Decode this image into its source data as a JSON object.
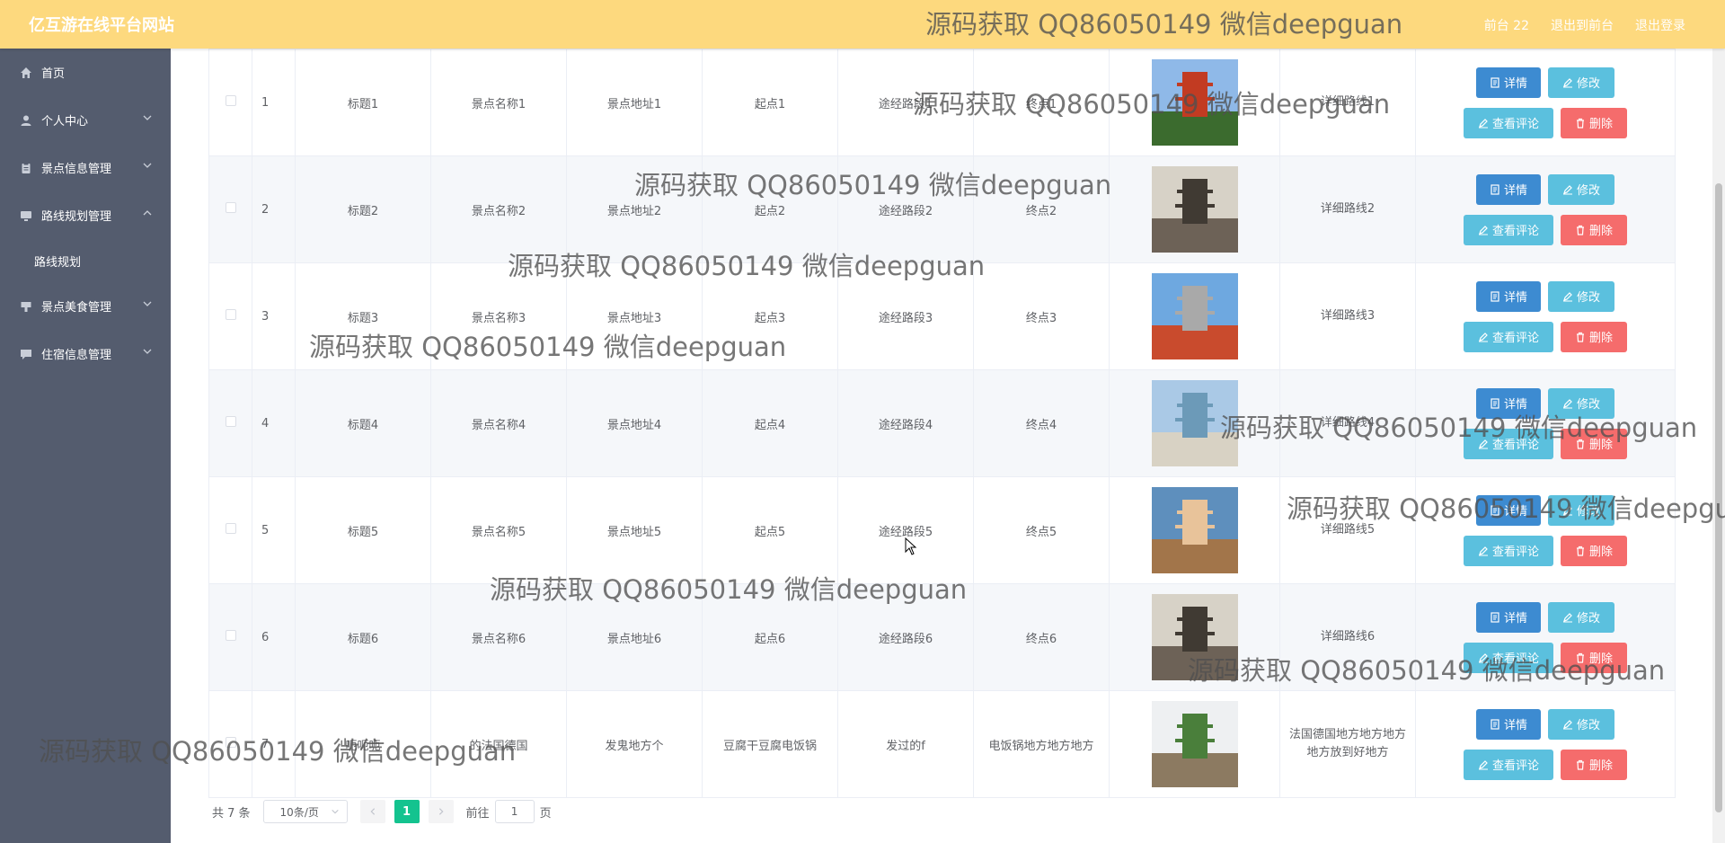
{
  "header": {
    "brand": "亿互游在线平台网站",
    "links": [
      "前台 22",
      "退出到前台",
      "退出登录"
    ]
  },
  "sidebar": {
    "items": [
      {
        "label": "首页",
        "icon": "home-icon"
      },
      {
        "label": "个人中心",
        "icon": "user-icon"
      },
      {
        "label": "景点信息管理",
        "icon": "clipboard-icon"
      },
      {
        "label": "路线规划管理",
        "icon": "monitor-icon"
      },
      {
        "label": "景点美食管理",
        "icon": "flag-icon"
      },
      {
        "label": "住宿信息管理",
        "icon": "chat-icon"
      }
    ],
    "sub_item": "路线规划"
  },
  "table": {
    "rows": [
      {
        "no": "1",
        "title": "标题1",
        "spot": "景点名称1",
        "addr": "景点地址1",
        "start": "起点1",
        "via": "途经路段1",
        "end": "终点1",
        "detail": "详细路线1"
      },
      {
        "no": "2",
        "title": "标题2",
        "spot": "景点名称2",
        "addr": "景点地址2",
        "start": "起点2",
        "via": "途经路段2",
        "end": "终点2",
        "detail": "详细路线2"
      },
      {
        "no": "3",
        "title": "标题3",
        "spot": "景点名称3",
        "addr": "景点地址3",
        "start": "起点3",
        "via": "途经路段3",
        "end": "终点3",
        "detail": "详细路线3"
      },
      {
        "no": "4",
        "title": "标题4",
        "spot": "景点名称4",
        "addr": "景点地址4",
        "start": "起点4",
        "via": "途经路段4",
        "end": "终点4",
        "detail": "详细路线4"
      },
      {
        "no": "5",
        "title": "标题5",
        "spot": "景点名称5",
        "addr": "景点地址5",
        "start": "起点5",
        "via": "途经路段5",
        "end": "终点5",
        "detail": "详细路线5"
      },
      {
        "no": "6",
        "title": "标题6",
        "spot": "景点名称6",
        "addr": "景点地址6",
        "start": "起点6",
        "via": "途经路段6",
        "end": "终点6",
        "detail": "详细路线6"
      },
      {
        "no": "7",
        "title": "呃呃呃",
        "spot": "的法国德国",
        "addr": "发鬼地方个",
        "start": "豆腐干豆腐电饭锅",
        "via": "发过的f",
        "end": "电饭锅地方地方地方",
        "detail": "法国德国地方地方地方地方放到好地方"
      }
    ],
    "buttons": {
      "detail": "详情",
      "edit": "修改",
      "review": "查看评论",
      "delete": "删除"
    }
  },
  "pagination": {
    "total": "共 7 条",
    "page_size": "10条/页",
    "current": "1",
    "goto_prefix": "前往",
    "goto_value": "1",
    "goto_suffix": "页"
  },
  "watermark": "源码获取 QQ86050149 微信deepguan",
  "colors": {
    "topbar": "#fdd97e",
    "sidebar": "#545c6e",
    "primary": "#3d8bd1",
    "info": "#5bc0de",
    "danger": "#f56c6c",
    "page_active": "#14c38f"
  }
}
